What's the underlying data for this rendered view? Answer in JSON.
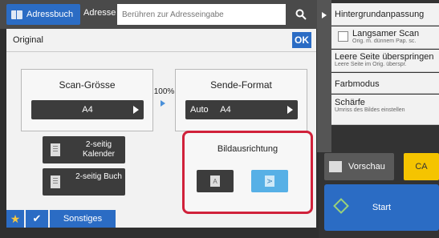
{
  "header": {
    "addressbook_label": "Adressbuch",
    "address_label": "Adresse",
    "search_placeholder": "Berühren zur Adresseingabe"
  },
  "panel": {
    "title": "Original",
    "ok_label": "OK",
    "scan_size": {
      "title": "Scan-Grösse",
      "value": "A4"
    },
    "ratio": "100%",
    "send_format": {
      "title": "Sende-Format",
      "value": "Auto     A4"
    },
    "duplex_calendar": "2-seitig Kalender",
    "duplex_book": "2-seitig Buch",
    "orientation": {
      "title": "Bildausrichtung",
      "portrait_glyph": "A",
      "landscape_glyph": "A",
      "selected": "landscape"
    }
  },
  "bottom": {
    "sonstiges_label": "Sonstiges"
  },
  "right_panel": {
    "items": [
      {
        "title": "Hintergrundanpassung",
        "sub": ""
      },
      {
        "title": "Langsamer Scan",
        "sub": "Orig. m. dünnem Pap. sc."
      },
      {
        "title": "Leere Seite überspringen",
        "sub": "Leere Seite im Orig. überspr."
      },
      {
        "title": "Farbmodus",
        "sub": ""
      },
      {
        "title": "Schärfe",
        "sub": "Umriss des Bildes einstellen"
      }
    ],
    "preview_label": "Vorschau",
    "ca_label": "CA",
    "start_label": "Start"
  },
  "colors": {
    "accent_blue": "#2b6cc4",
    "highlight_red": "#d0213a",
    "selected_light_blue": "#57b0e6",
    "ca_yellow": "#f5c400"
  }
}
